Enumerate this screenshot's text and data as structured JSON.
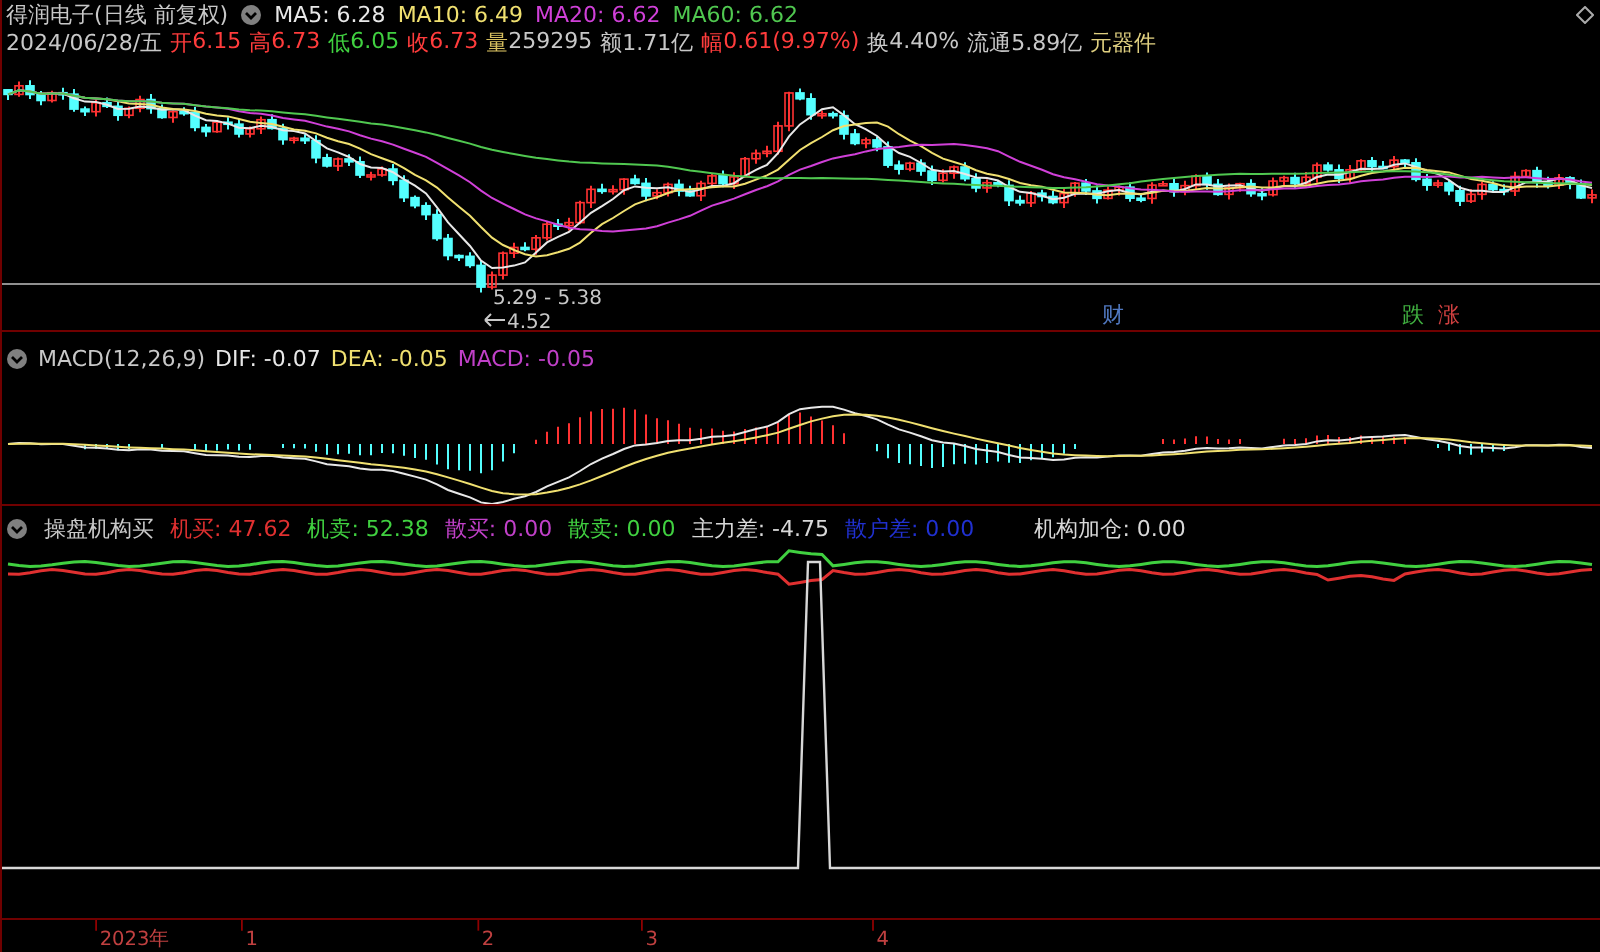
{
  "title": "得润电子(日线 前复权)",
  "ma": [
    {
      "label": "MA5: 6.28",
      "color": "#e8e8e8"
    },
    {
      "label": "MA10: 6.49",
      "color": "#f0e070"
    },
    {
      "label": "MA20: 6.62",
      "color": "#d040d8"
    },
    {
      "label": "MA60: 6.62",
      "color": "#50c850"
    }
  ],
  "date": "2024/06/28/五",
  "quote": [
    {
      "label": "开",
      "value": "6.15",
      "kind": "rise"
    },
    {
      "label": "高",
      "value": "6.73",
      "kind": "rise"
    },
    {
      "label": "低",
      "value": "6.05",
      "kind": "fall"
    },
    {
      "label": "收",
      "value": "6.73",
      "kind": "rise"
    },
    {
      "label": "量",
      "value": "259295",
      "kind": "volume"
    },
    {
      "label": "额",
      "value": "1.71亿",
      "kind": "plain"
    },
    {
      "label": "幅",
      "value": "0.61(9.97%)",
      "kind": "rise"
    },
    {
      "label": "换",
      "value": "4.40%",
      "kind": "plain"
    },
    {
      "label": "流通",
      "value": "5.89亿",
      "kind": "plain"
    }
  ],
  "sector": "元器件",
  "price_range": "5.29 - 5.38",
  "price_low": "4.52",
  "events": [
    {
      "label": "财",
      "color": "#5078c0"
    },
    {
      "label": "跌",
      "color": "#40b040"
    },
    {
      "label": "涨",
      "color": "#d04040"
    }
  ],
  "macd": {
    "name": "MACD(12,26,9)",
    "items": [
      {
        "text": "DIF: -0.07",
        "color": "#e8e8e8"
      },
      {
        "text": "DEA: -0.05",
        "color": "#f0e070"
      },
      {
        "text": "MACD: -0.05",
        "color": "#c040c8"
      }
    ]
  },
  "indicator": {
    "name": "操盘机构买",
    "items": [
      {
        "text": "机买: 47.62",
        "color": "#e03030"
      },
      {
        "text": "机卖: 52.38",
        "color": "#40d040"
      },
      {
        "text": "散买: 0.00",
        "color": "#c040c8"
      },
      {
        "text": "散卖: 0.00",
        "color": "#40d040"
      },
      {
        "text": "主力差: -4.75",
        "color": "#d8d8d8"
      },
      {
        "text": "散户差: 0.00",
        "color": "#2030d0"
      },
      {
        "text": "机构加仓: 0.00",
        "color": "#d8d8d8"
      }
    ]
  },
  "axis": [
    "2023年",
    "1",
    "2",
    "3",
    "4"
  ]
}
